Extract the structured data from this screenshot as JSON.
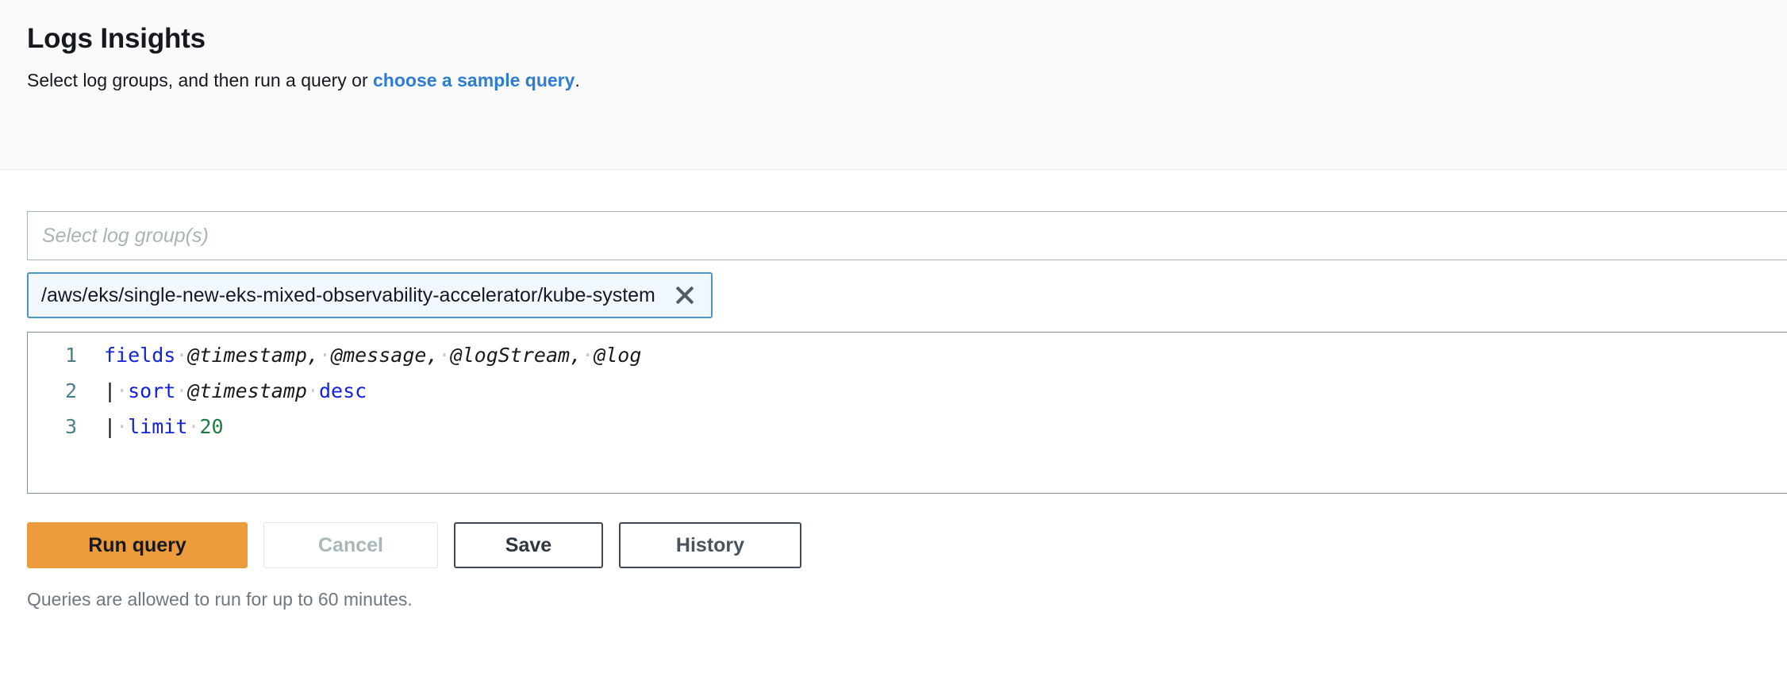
{
  "header": {
    "title": "Logs Insights",
    "subtitle_prefix": "Select log groups, and then run a query or ",
    "subtitle_link": "choose a sample query",
    "subtitle_suffix": "."
  },
  "log_group_select": {
    "placeholder": "Select log group(s)",
    "value": ""
  },
  "selected_log_group": {
    "label": "/aws/eks/single-new-eks-mixed-observability-accelerator/kube-system",
    "remove_icon": "close-icon"
  },
  "query_editor": {
    "lines": [
      {
        "number": "1",
        "tokens": [
          {
            "text": "fields",
            "type": "keyword"
          },
          {
            "text": " ",
            "type": "space"
          },
          {
            "text": "@timestamp,",
            "type": "field"
          },
          {
            "text": " ",
            "type": "space"
          },
          {
            "text": "@message,",
            "type": "field"
          },
          {
            "text": " ",
            "type": "space"
          },
          {
            "text": "@logStream,",
            "type": "field"
          },
          {
            "text": " ",
            "type": "space"
          },
          {
            "text": "@log",
            "type": "field"
          }
        ]
      },
      {
        "number": "2",
        "tokens": [
          {
            "text": "|",
            "type": "pipe"
          },
          {
            "text": " ",
            "type": "space"
          },
          {
            "text": "sort",
            "type": "keyword"
          },
          {
            "text": " ",
            "type": "space"
          },
          {
            "text": "@timestamp",
            "type": "field"
          },
          {
            "text": " ",
            "type": "space"
          },
          {
            "text": "desc",
            "type": "keyword"
          }
        ]
      },
      {
        "number": "3",
        "tokens": [
          {
            "text": "|",
            "type": "pipe"
          },
          {
            "text": " ",
            "type": "space"
          },
          {
            "text": "limit",
            "type": "keyword"
          },
          {
            "text": " ",
            "type": "space"
          },
          {
            "text": "20",
            "type": "number"
          }
        ]
      }
    ]
  },
  "buttons": {
    "run": "Run query",
    "cancel": "Cancel",
    "save": "Save",
    "history": "History"
  },
  "footer": {
    "note": "Queries are allowed to run for up to 60 minutes."
  },
  "colors": {
    "accent_orange": "#ec9c3c",
    "link_blue": "#2d7dd2",
    "chip_border": "#4a95c4",
    "chip_background": "#f1f8fd",
    "keyword_blue": "#1122e0",
    "number_green": "#1e7b45",
    "gutter_teal": "#4f7f8b",
    "header_background": "#fafafa"
  }
}
